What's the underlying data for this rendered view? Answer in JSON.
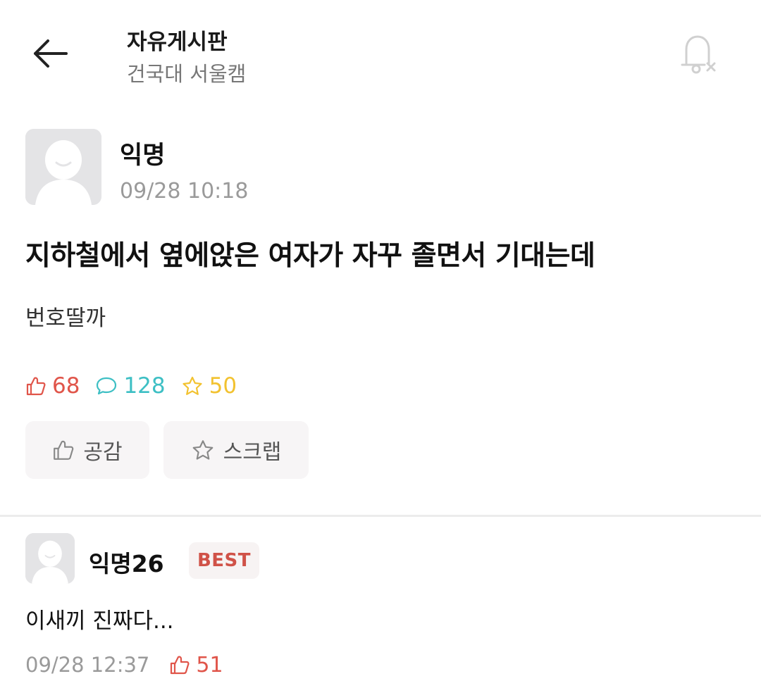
{
  "header": {
    "board_title": "자유게시판",
    "school": "건국대 서울캠"
  },
  "post": {
    "author": "익명",
    "time": "09/28 10:18",
    "title": "지하철에서 옆에앉은 여자가 자꾸 졸면서 기대는데",
    "body": "번호딸까",
    "stats": {
      "likes": "68",
      "comments": "128",
      "scraps": "50"
    },
    "buttons": {
      "like_label": "공감",
      "scrap_label": "스크랩"
    }
  },
  "comment": {
    "author": "익명26",
    "badge": "BEST",
    "body": "이새끼 진짜다...",
    "time": "09/28 12:37",
    "likes": "51"
  },
  "colors": {
    "like": "#e0554a",
    "comment": "#3dbfc4",
    "scrap": "#f2c230",
    "best": "#d05248"
  },
  "icons": {
    "back": "arrow-left-icon",
    "bell": "notification-off-icon",
    "like": "thumbs-up-icon",
    "comment": "speech-bubble-icon",
    "scrap": "star-icon"
  }
}
